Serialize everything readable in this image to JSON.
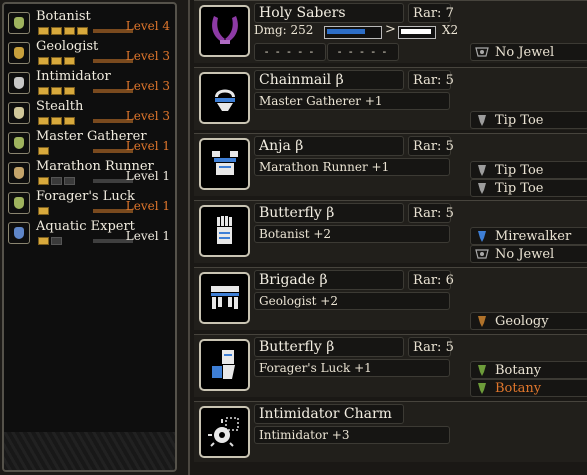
{
  "colors": {
    "level_orange": "#e0762c",
    "pip_gold": "#d8a93c",
    "sharpness_blue": "#2d6ec7",
    "sharpness_white": "#ffffff",
    "weapon_purple": "#8d3aa5",
    "armor_blue": "#3e7fd6"
  },
  "skills": [
    {
      "name": "Botanist",
      "level": "Level 4",
      "max": true,
      "icon_color": "#9fb35e",
      "pips": 4,
      "total_pips": 4
    },
    {
      "name": "Geologist",
      "level": "Level 3",
      "max": true,
      "icon_color": "#c8a03c",
      "pips": 3,
      "total_pips": 3
    },
    {
      "name": "Intimidator",
      "level": "Level 3",
      "max": true,
      "icon_color": "#c8c8c8",
      "pips": 3,
      "total_pips": 3
    },
    {
      "name": "Stealth",
      "level": "Level 3",
      "max": true,
      "icon_color": "#d0c79a",
      "pips": 3,
      "total_pips": 3
    },
    {
      "name": "Master Gatherer",
      "level": "Level 1",
      "max": true,
      "icon_color": "#9fb35e",
      "pips": 1,
      "total_pips": 1
    },
    {
      "name": "Marathon Runner",
      "level": "Level 1",
      "max": false,
      "icon_color": "#c4a46a",
      "pips": 1,
      "total_pips": 3
    },
    {
      "name": "Forager's Luck",
      "level": "Level 1",
      "max": true,
      "icon_color": "#9fb35e",
      "pips": 1,
      "total_pips": 1
    },
    {
      "name": "Aquatic Expert",
      "level": "Level 1",
      "max": false,
      "icon_color": "#5f86c9",
      "pips": 1,
      "total_pips": 2
    }
  ],
  "weapon": {
    "name": "Holy Sabers",
    "rarity": "Rar: 7",
    "damage": "Dmg: 252",
    "sharpness_arrow": ">",
    "sharpness_multiplier": "X2",
    "slot1": "- - - - -",
    "slot2": "- - - - -",
    "jewel": "No Jewel",
    "icon": "dual-blades-icon"
  },
  "armor": [
    {
      "name": "Chainmail β",
      "rarity": "Rar: 5",
      "skill": "Master Gatherer +1",
      "icon": "helm-icon",
      "decos": [
        {
          "label": "Tip Toe",
          "icon": "jewel-icon",
          "highlight": false
        }
      ]
    },
    {
      "name": "Anja β",
      "rarity": "Rar: 5",
      "skill": "Marathon Runner +1",
      "icon": "chest-icon",
      "decos": [
        {
          "label": "Tip Toe",
          "icon": "jewel-icon",
          "highlight": false
        },
        {
          "label": "Tip Toe",
          "icon": "jewel-icon",
          "highlight": false
        }
      ]
    },
    {
      "name": "Butterfly β",
      "rarity": "Rar: 5",
      "skill": "Botanist +2",
      "icon": "gauntlet-icon",
      "decos": [
        {
          "label": "Mirewalker",
          "icon": "jewel-icon",
          "highlight": false
        },
        {
          "label": "No Jewel",
          "icon": "empty-jewel-icon",
          "highlight": false
        }
      ]
    },
    {
      "name": "Brigade β",
      "rarity": "Rar: 6",
      "skill": "Geologist +2",
      "icon": "waist-icon",
      "decos": [
        {
          "label": "Geology",
          "icon": "jewel-icon",
          "highlight": false
        }
      ]
    },
    {
      "name": "Butterfly β",
      "rarity": "Rar: 5",
      "skill": "Forager's Luck +1",
      "icon": "legs-icon",
      "decos": [
        {
          "label": "Botany",
          "icon": "jewel-icon",
          "highlight": false
        },
        {
          "label": "Botany",
          "icon": "jewel-icon",
          "highlight": true
        }
      ]
    },
    {
      "name": "Intimidator Charm",
      "rarity": "",
      "skill": "Intimidator +3",
      "icon": "charm-icon",
      "decos": []
    }
  ]
}
